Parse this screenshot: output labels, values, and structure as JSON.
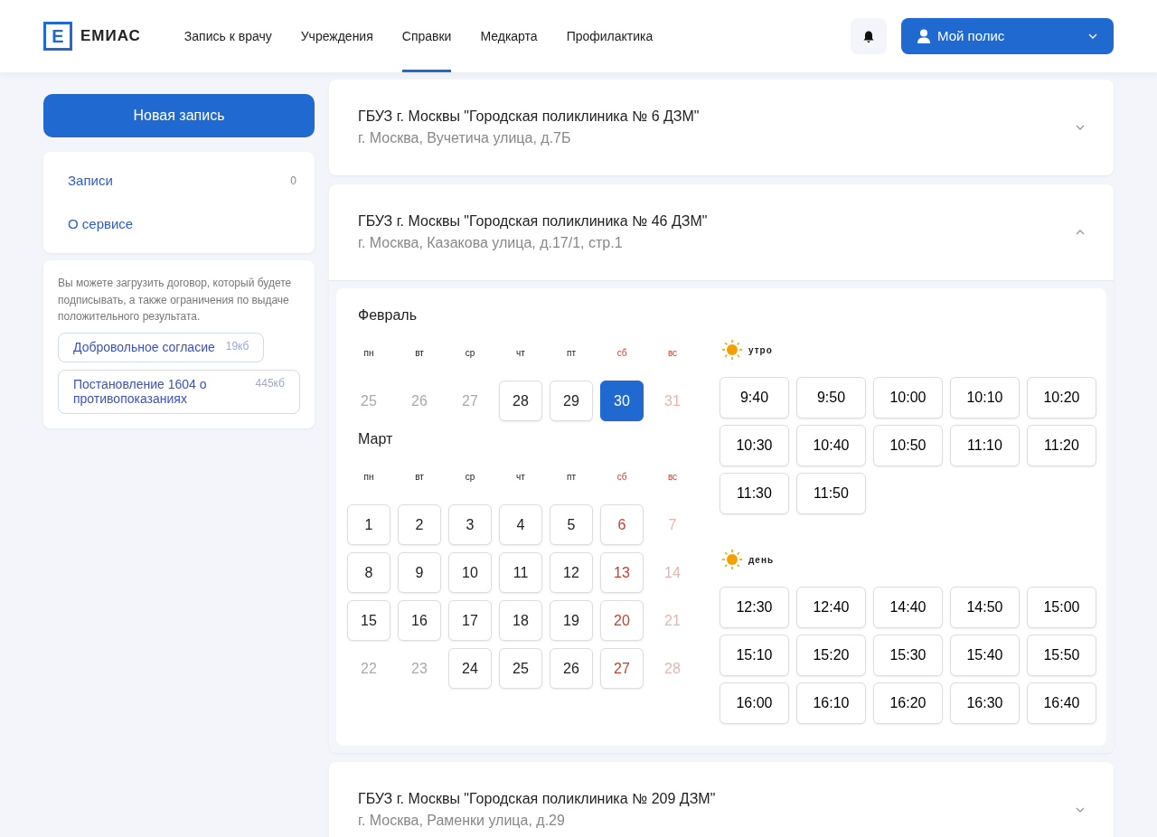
{
  "header": {
    "logo_letter": "Е",
    "logo_text": "ЕМИАС",
    "nav": [
      {
        "label": "Запись к врачу",
        "selected": false
      },
      {
        "label": "Учреждения",
        "selected": false
      },
      {
        "label": "Справки",
        "selected": true
      },
      {
        "label": "Медкарта",
        "selected": false
      },
      {
        "label": "Профилактика",
        "selected": false
      }
    ],
    "policy_button": "Мой полис"
  },
  "sidebar": {
    "new_button": "Новая запись",
    "menu": [
      {
        "label": "Записи",
        "count": "0"
      },
      {
        "label": "О сервисе"
      }
    ],
    "info_text": "Вы можете загрузить договор, который будете подписывать, а также ограничения по выдаче положительного результата.",
    "documents": [
      {
        "title": "Добровольное согласие",
        "size": "19кб"
      },
      {
        "title": "Постановление 1604 о противопоказаниях",
        "size": "445кб"
      }
    ]
  },
  "clinics": [
    {
      "name": "ГБУЗ г. Москвы \"Городская поликлиника № 6 ДЗМ\"",
      "address": "г. Москва, Вучетича улица, д.7Б",
      "expanded": false
    },
    {
      "name": "ГБУЗ г. Москвы \"Городская поликлиника № 46 ДЗМ\"",
      "address": "г. Москва, Казакова улица, д.17/1, стр.1",
      "expanded": true,
      "schedule": {
        "months": [
          {
            "title": "Февраль",
            "weekdays": [
              {
                "label": "пн",
                "weekend": false
              },
              {
                "label": "вт",
                "weekend": false
              },
              {
                "label": "ср",
                "weekend": false
              },
              {
                "label": "чт",
                "weekend": false
              },
              {
                "label": "пт",
                "weekend": false
              },
              {
                "label": "сб",
                "weekend": true
              },
              {
                "label": "вс",
                "weekend": true
              }
            ],
            "weeks": [
              [
                {
                  "label": "25",
                  "available": false
                },
                {
                  "label": "26",
                  "available": false
                },
                {
                  "label": "27",
                  "available": false
                },
                {
                  "label": "28",
                  "available": true,
                  "selected": false
                },
                {
                  "label": "29",
                  "available": true,
                  "selected": false
                },
                {
                  "label": "30",
                  "available": true,
                  "selected": true
                },
                {
                  "label": "31",
                  "available": false
                }
              ]
            ]
          },
          {
            "title": "Март",
            "weekdays": [
              {
                "label": "пн",
                "weekend": false
              },
              {
                "label": "вт",
                "weekend": false
              },
              {
                "label": "ср",
                "weekend": false
              },
              {
                "label": "чт",
                "weekend": false
              },
              {
                "label": "пт",
                "weekend": false
              },
              {
                "label": "сб",
                "weekend": true
              },
              {
                "label": "вс",
                "weekend": true
              }
            ],
            "weeks": [
              [
                {
                  "label": "1",
                  "available": true,
                  "selected": false
                },
                {
                  "label": "2",
                  "available": true,
                  "selected": false
                },
                {
                  "label": "3",
                  "available": true,
                  "selected": false
                },
                {
                  "label": "4",
                  "available": true,
                  "selected": false
                },
                {
                  "label": "5",
                  "available": true,
                  "selected": false
                },
                {
                  "label": "6",
                  "available": true,
                  "selected": false
                },
                {
                  "label": "7",
                  "available": false
                }
              ],
              [
                {
                  "label": "8",
                  "available": true,
                  "selected": false
                },
                {
                  "label": "9",
                  "available": true,
                  "selected": false
                },
                {
                  "label": "10",
                  "available": true,
                  "selected": false
                },
                {
                  "label": "11",
                  "available": true,
                  "selected": false
                },
                {
                  "label": "12",
                  "available": true,
                  "selected": false
                },
                {
                  "label": "13",
                  "available": true,
                  "selected": false
                },
                {
                  "label": "14",
                  "available": false
                }
              ],
              [
                {
                  "label": "15",
                  "available": true,
                  "selected": false
                },
                {
                  "label": "16",
                  "available": true,
                  "selected": false
                },
                {
                  "label": "17",
                  "available": true,
                  "selected": false
                },
                {
                  "label": "18",
                  "available": true,
                  "selected": false
                },
                {
                  "label": "19",
                  "available": true,
                  "selected": false
                },
                {
                  "label": "20",
                  "available": true,
                  "selected": false
                },
                {
                  "label": "21",
                  "available": false
                }
              ],
              [
                {
                  "label": "22",
                  "available": false
                },
                {
                  "label": "23",
                  "available": false
                },
                {
                  "label": "24",
                  "available": true,
                  "selected": false
                },
                {
                  "label": "25",
                  "available": true,
                  "selected": false
                },
                {
                  "label": "26",
                  "available": true,
                  "selected": false
                },
                {
                  "label": "27",
                  "available": true,
                  "selected": false
                },
                {
                  "label": "28",
                  "available": false
                }
              ]
            ]
          }
        ],
        "periods": [
          {
            "title": "утро",
            "times": [
              "9:40",
              "9:50",
              "10:00",
              "10:10",
              "10:20",
              "10:30",
              "10:40",
              "10:50",
              "11:10",
              "11:20",
              "11:30",
              "11:50"
            ]
          },
          {
            "title": "день",
            "times": [
              "12:30",
              "12:40",
              "14:40",
              "14:50",
              "15:00",
              "15:10",
              "15:20",
              "15:30",
              "15:40",
              "15:50",
              "16:00",
              "16:10",
              "16:20",
              "16:30",
              "16:40"
            ]
          }
        ]
      }
    },
    {
      "name": "ГБУЗ г. Москвы \"Городская поликлиника № 209 ДЗМ\"",
      "address": "г. Москва, Раменки улица, д.29",
      "expanded": false
    }
  ]
}
